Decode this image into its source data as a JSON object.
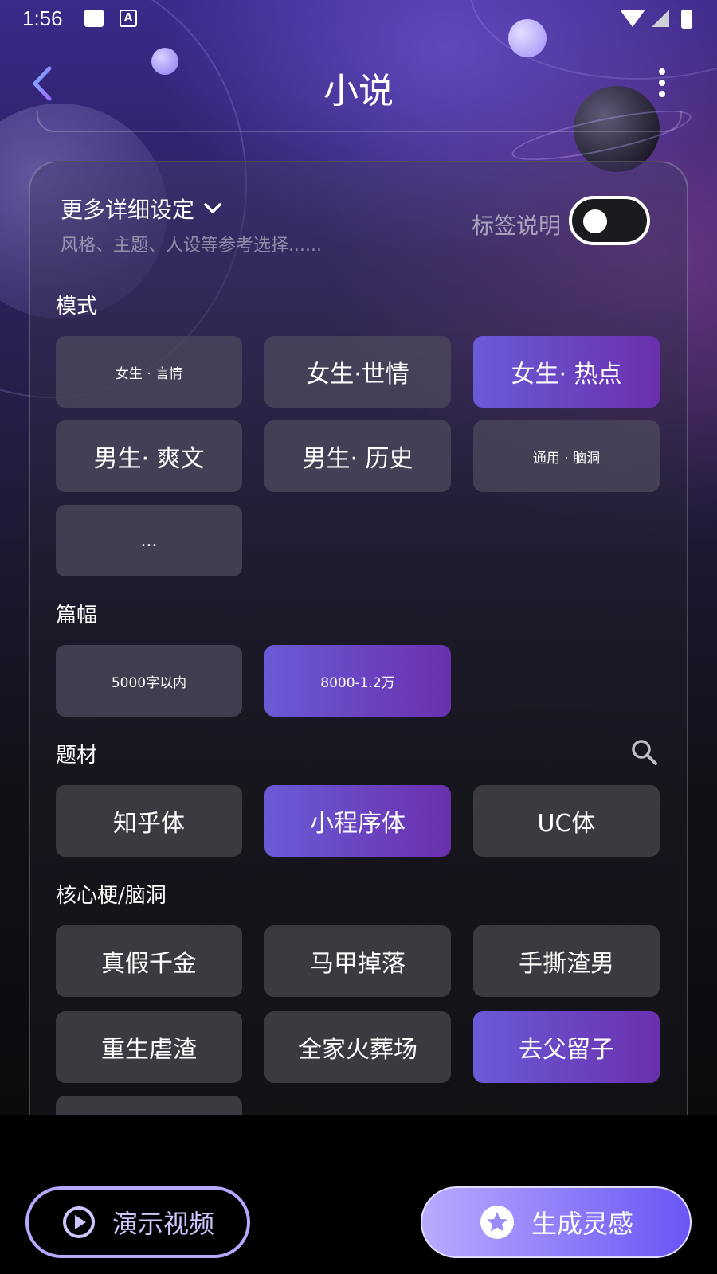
{
  "status_bar": {
    "time": "1:56",
    "a_icon_letter": "A"
  },
  "header": {
    "title": "小说"
  },
  "settings": {
    "more_label": "更多详细设定",
    "subtitle": "风格、主题、人设等参考选择......",
    "tag_note_label": "标签说明",
    "tag_note_toggle_on": false
  },
  "sections": {
    "mode": {
      "title": "模式",
      "chips": [
        "女生 · 言情",
        "女生·世情",
        "女生· 热点",
        "男生· 爽文",
        "男生· 历史",
        "通用 · 脑洞",
        "..."
      ],
      "selected": "女生· 热点"
    },
    "length": {
      "title": "篇幅",
      "chips": [
        "5000字以内",
        "8000-1.2万"
      ],
      "selected": "8000-1.2万"
    },
    "topic": {
      "title": "题材",
      "chips": [
        "知乎体",
        "小程序体",
        "UC体"
      ],
      "selected": "小程序体"
    },
    "core": {
      "title": "核心梗/脑洞",
      "chips": [
        "真假千金",
        "马甲掉落",
        "手撕渣男",
        "重生虐渣",
        "全家火葬场",
        "去父留子"
      ],
      "selected": "去父留子"
    }
  },
  "footer": {
    "demo_label": "演示视频",
    "generate_label": "生成灵感"
  },
  "colors": {
    "accent_start": "#6a5bd6",
    "accent_end": "#6b2fae",
    "button_outline": "#b6a8ff"
  }
}
